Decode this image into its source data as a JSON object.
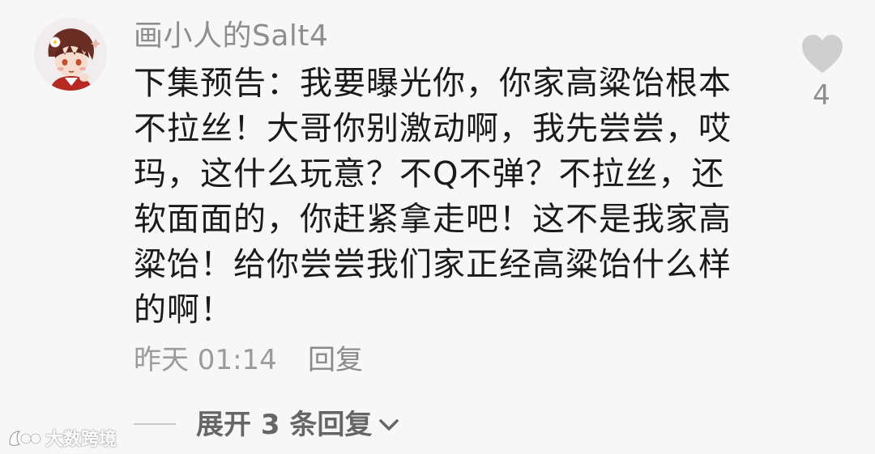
{
  "comment": {
    "author": "画小人的Salt4",
    "text": "下集预告：我要曝光你，你家高粱饴根本不拉丝！大哥你别激动啊，我先尝尝，哎玛，这什么玩意？不Q不弹？不拉丝，还软面面的，你赶紧拿走吧！这不是我家高粱饴！给你尝尝我们家正经高粱饴什么样的啊！",
    "timestamp": "昨天 01:14",
    "reply_label": "回复",
    "like_count": "4",
    "expand_label": "展开 3 条回复"
  },
  "icons": {
    "avatar": "avatar-image",
    "like": "heart-icon",
    "expand": "chevron-down-icon"
  },
  "watermark": {
    "text": "大数跨境"
  },
  "colors": {
    "background": "#f7f7f7",
    "text_primary": "#1a1a1a",
    "text_secondary": "#8e8e8e",
    "heart": "#cfcfcf"
  }
}
